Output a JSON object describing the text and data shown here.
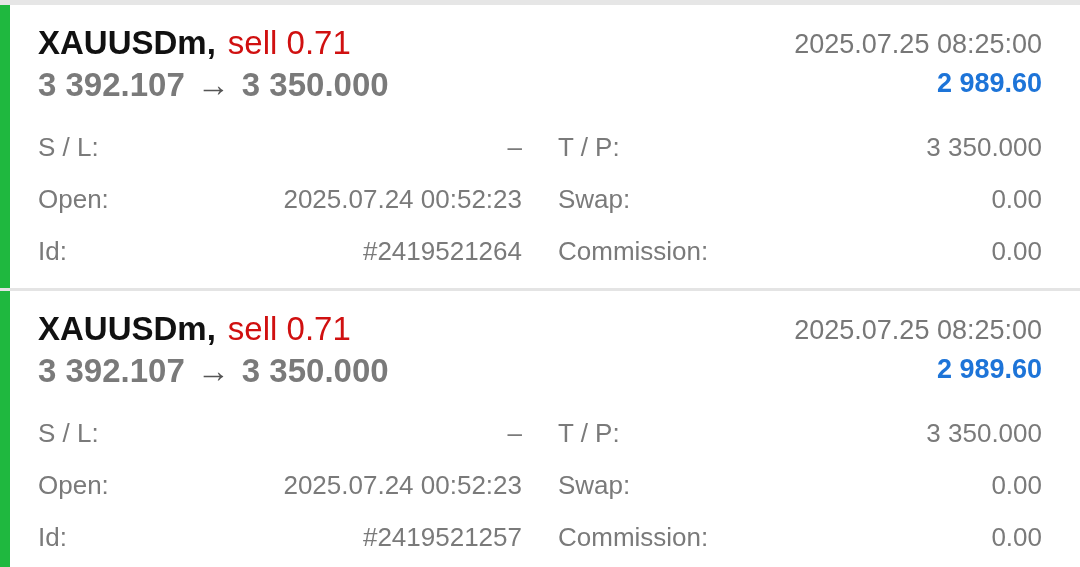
{
  "positions": [
    {
      "symbol": "XAUUSDm,",
      "side": "sell 0.71",
      "open_price": "3 392.107",
      "arrow": "→",
      "close_price": "3 350.000",
      "time": "2025.07.25 08:25:00",
      "profit": "2 989.60",
      "details": [
        {
          "label": "S / L:",
          "value": "–"
        },
        {
          "label": "T / P:",
          "value": "3 350.000"
        },
        {
          "label": "Open:",
          "value": "2025.07.24 00:52:23"
        },
        {
          "label": "Swap:",
          "value": "0.00"
        },
        {
          "label": "Id:",
          "value": "#2419521264"
        },
        {
          "label": "Commission:",
          "value": "0.00"
        }
      ]
    },
    {
      "symbol": "XAUUSDm,",
      "side": "sell 0.71",
      "open_price": "3 392.107",
      "arrow": "→",
      "close_price": "3 350.000",
      "time": "2025.07.25 08:25:00",
      "profit": "2 989.60",
      "details": [
        {
          "label": "S / L:",
          "value": "–"
        },
        {
          "label": "T / P:",
          "value": "3 350.000"
        },
        {
          "label": "Open:",
          "value": "2025.07.24 00:52:23"
        },
        {
          "label": "Swap:",
          "value": "0.00"
        },
        {
          "label": "Id:",
          "value": "#2419521257"
        },
        {
          "label": "Commission:",
          "value": "0.00"
        }
      ]
    }
  ]
}
